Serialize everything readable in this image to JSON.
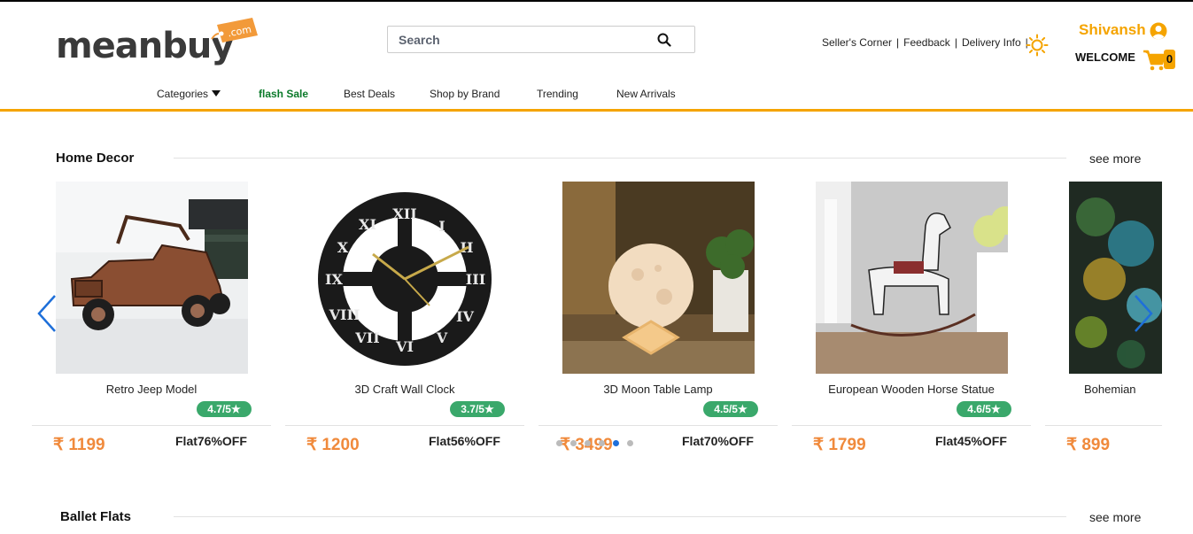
{
  "header": {
    "logo_text": "meanbuy",
    "logo_tag": ".com",
    "search_placeholder": "Search",
    "links": [
      "Seller's Corner",
      "Feedback",
      "Delivery Info"
    ],
    "user_name": "Shivansh",
    "welcome": "WELCOME",
    "cart_count": "0"
  },
  "nav": {
    "categories": "Categories",
    "flash_sale": "flash Sale",
    "best_deals": "Best Deals",
    "shop_by_brand": "Shop by Brand",
    "trending": "Trending",
    "new_arrivals": "New Arrivals"
  },
  "home_decor": {
    "title": "Home Decor",
    "see_more": "see more",
    "products": [
      {
        "name": "Retro Jeep Model",
        "rating": "4.7/5",
        "price": "₹ 1199",
        "discount": "Flat76%OFF"
      },
      {
        "name": "3D Craft Wall Clock",
        "rating": "3.7/5",
        "price": "₹ 1200",
        "discount": "Flat56%OFF"
      },
      {
        "name": "3D Moon Table Lamp",
        "rating": "4.5/5",
        "price": "₹ 3499",
        "discount": "Flat70%OFF"
      },
      {
        "name": "European Wooden Horse Statue",
        "rating": "4.6/5",
        "price": "₹ 1799",
        "discount": "Flat45%OFF"
      },
      {
        "name": "Bohemian",
        "price": "₹ 899"
      }
    ]
  },
  "ballet_flats": {
    "title": "Ballet Flats",
    "see_more": "see more"
  },
  "colors": {
    "accent": "#f5a400",
    "price": "#f08a3c",
    "rating": "#3aa86b",
    "flash": "#0b7a2a",
    "arrow": "#1e6fd9"
  }
}
